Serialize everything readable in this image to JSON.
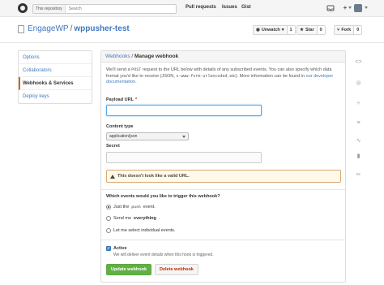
{
  "header": {
    "scope_label": "This repository",
    "search_placeholder": "Search",
    "nav": [
      "Pull requests",
      "Issues",
      "Gist"
    ]
  },
  "repo": {
    "owner": "EngageWP",
    "separator": "/",
    "name": "wppusher-test",
    "watch_label": "Unwatch",
    "watch_count": "1",
    "star_label": "Star",
    "star_count": "0",
    "fork_label": "Fork",
    "fork_count": "0"
  },
  "sidebar": {
    "items": [
      {
        "label": "Options",
        "selected": false
      },
      {
        "label": "Collaborators",
        "selected": false
      },
      {
        "label": "Webhooks & Services",
        "selected": true
      },
      {
        "label": "Deploy keys",
        "selected": false
      }
    ]
  },
  "panel": {
    "crumb_link": "Webhooks",
    "crumb_sep": " / ",
    "crumb_current": "Manage webhook",
    "intro_1": "We'll send a ",
    "intro_code_post": "POST",
    "intro_2": " request to the URL below with details of any subscribed events. You can also specify which data format you'd like to receive (JSON, ",
    "intro_code_form": "x-www-form-urlencoded",
    "intro_3": ", etc). More information can be found in ",
    "intro_link": "our developer documentation",
    "intro_4": ".",
    "payload_label": "Payload URL",
    "payload_required": "*",
    "payload_value": "",
    "content_type_label": "Content type",
    "content_type_value": "application/json",
    "secret_label": "Secret",
    "secret_value": "",
    "warning": "This doesn't look like a valid URL.",
    "events_question": "Which events would you like to trigger this webhook?",
    "events": {
      "just_push_1": "Just the ",
      "just_push_code": "push",
      "just_push_2": " event.",
      "everything_1": "Send me ",
      "everything_bold": "everything",
      "everything_2": ".",
      "individual": "Let me select individual events."
    },
    "selected_event": "just_push",
    "active_label": "Active",
    "active_checked": true,
    "active_note": "We will deliver event details when this hook is triggered.",
    "update_button": "Update webhook",
    "delete_button": "Delete webhook"
  },
  "colors": {
    "link": "#4078c0",
    "accent_selected": "#d26911",
    "primary_button": "#60b044",
    "danger_text": "#bd2c00",
    "warning_bg": "#fff9ea"
  },
  "icons": {
    "header": [
      "octocat-icon",
      "notifications-icon",
      "plus-icon",
      "avatar"
    ],
    "repo_nav": [
      "code-icon",
      "issues-icon",
      "pull-request-icon",
      "wiki-icon",
      "pulse-icon",
      "graphs-icon",
      "settings-icon"
    ]
  }
}
